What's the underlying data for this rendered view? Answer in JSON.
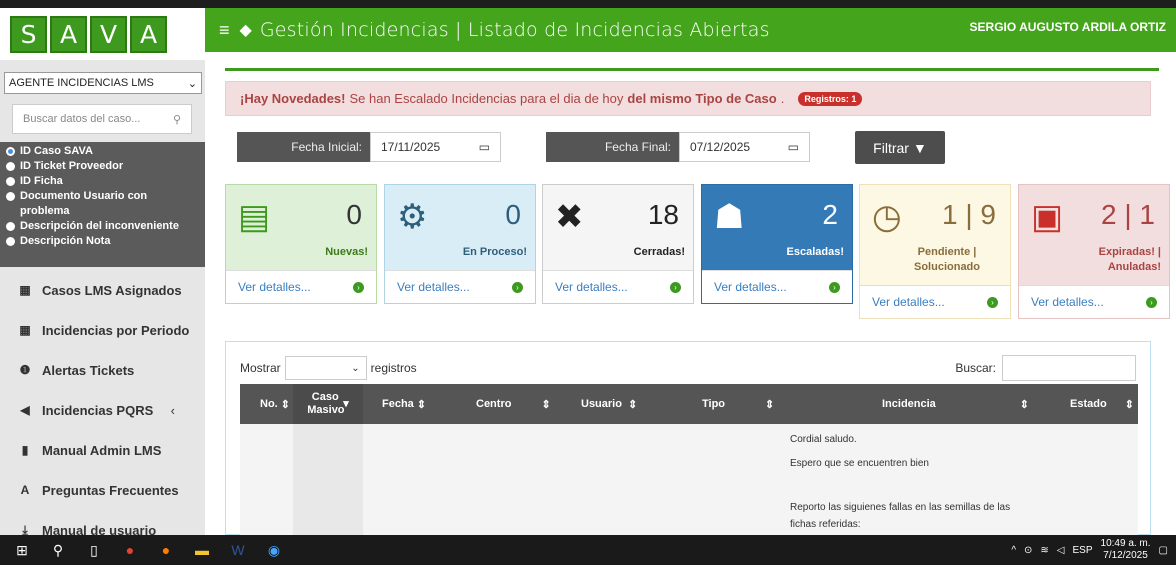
{
  "logo": {
    "letters": [
      "S",
      "A",
      "V",
      "A"
    ]
  },
  "header": {
    "title": "Gestión Incidencias | Listado de Incidencias Abiertas",
    "user": "SERGIO AUGUSTO ARDILA ORTIZ"
  },
  "sidebar": {
    "role": "AGENTE INCIDENCIAS LMS",
    "search_placeholder": "Buscar datos del caso...",
    "options": [
      "ID Caso SAVA",
      "ID Ticket Proveedor",
      "ID Ficha",
      "Documento Usuario con problema",
      "Descripción del inconveniente",
      "Descripción Nota"
    ],
    "nav": [
      "Casos LMS Asignados",
      "Incidencias por Periodo",
      "Alertas Tickets",
      "Incidencias PQRS",
      "Manual Admin LMS",
      "Preguntas Frecuentes",
      "Manual de usuario"
    ]
  },
  "alert": {
    "strong1": "¡Hay Novedades!",
    "text": " Se han Escalado Incidencias para el dia de hoy ",
    "strong2": "del mismo Tipo de Caso",
    "dot": ".",
    "badge": "Registros: 1"
  },
  "filters": {
    "start_label": "Fecha Inicial:",
    "start_value": "17/11/2025",
    "end_label": "Fecha Final:",
    "end_value": "07/12/2025",
    "button": "Filtrar"
  },
  "cards": [
    {
      "num": "0",
      "label": "Nuevas!",
      "link": "Ver detalles..."
    },
    {
      "num": "0",
      "label": "En Proceso!",
      "link": "Ver detalles..."
    },
    {
      "num": "18",
      "label": "Cerradas!",
      "link": "Ver detalles..."
    },
    {
      "num": "2",
      "label": "Escaladas!",
      "link": "Ver detalles..."
    },
    {
      "num": "1 | 9",
      "label": "Pendiente | Solucionado",
      "link": "Ver detalles..."
    },
    {
      "num": "2 | 1",
      "label": "Expiradas! | Anuladas!",
      "link": "Ver detalles..."
    }
  ],
  "table": {
    "show": "Mostrar",
    "records": "registros",
    "search": "Buscar:",
    "headers": [
      "No.",
      "Caso Masivo",
      "Fecha",
      "Centro",
      "Usuario",
      "Tipo",
      "Incidencia",
      "Estado"
    ],
    "body_lines": [
      "Cordial saludo.",
      "Espero que se encuentren bien",
      "Reporto las siguienes fallas en las semillas de las",
      "fichas referidas:"
    ]
  },
  "taskbar": {
    "lang": "ESP",
    "time": "10:49 a. m.",
    "date": "7/12/2025"
  },
  "colors": {
    "green": "#44a51c",
    "blue": "#3a7fc1",
    "alert_bg": "#f2dede"
  }
}
